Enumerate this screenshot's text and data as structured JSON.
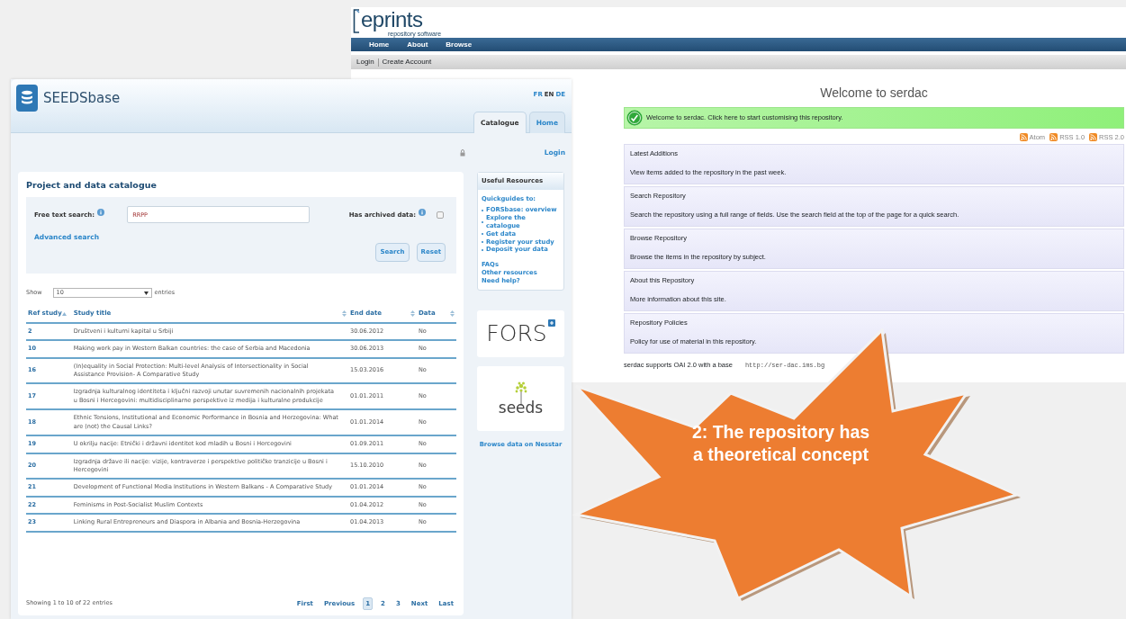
{
  "eprints": {
    "logo_text": "eprints",
    "logo_subtitle": "repository software",
    "nav": [
      "Home",
      "About",
      "Browse"
    ],
    "account_links": [
      "Login",
      "Create Account"
    ],
    "title": "Welcome to serdac",
    "notice": {
      "text": "Welcome to serdac.",
      "link": "Click here to start customising this repository."
    },
    "feeds": [
      "Atom",
      "RSS 1.0",
      "RSS 2.0"
    ],
    "panels": [
      {
        "link": "Latest Additions",
        "description": "View items added to the repository in the past week."
      },
      {
        "link": "Search Repository",
        "description": "Search the repository using a full range of fields. Use the search field at the top of the page for a quick search."
      },
      {
        "link": "Browse Repository",
        "description": "Browse the items in the repository by subject."
      },
      {
        "link": "About this Repository",
        "description": "More information about this site."
      },
      {
        "link": "Repository Policies",
        "description": "Policy for use of material in this repository."
      }
    ],
    "footer": {
      "text": "serdac supports",
      "link": "OAI 2.0",
      "text_after": "with a base",
      "url": "http://ser-dac.ims.bg"
    }
  },
  "seedsbase": {
    "brand": "SEEDSbase",
    "languages": [
      {
        "label": "FR",
        "selected": false
      },
      {
        "label": "EN",
        "selected": true
      },
      {
        "label": "DE",
        "selected": false
      }
    ],
    "tabs": [
      {
        "label": "Catalogue",
        "selected": true
      },
      {
        "label": "Home",
        "selected": false
      }
    ],
    "login": "Login",
    "catalogue": {
      "title": "Project and data catalogue",
      "search_label": "Free text search:",
      "search_value": "RRPP",
      "archived_label": "Has archived data:",
      "archived_checked": false,
      "advanced_link": "Advanced search",
      "buttons": [
        "Search",
        "Reset"
      ]
    },
    "length": {
      "show": "Show",
      "value": "10",
      "entries": "entries"
    },
    "table": {
      "columns": [
        {
          "label": "Ref study",
          "sorted": true
        },
        {
          "label": "Study title",
          "sorted": false
        },
        {
          "label": "End date",
          "sorted": false
        },
        {
          "label": "Data",
          "sorted": false
        }
      ],
      "rows": [
        [
          "2",
          "Društveni i kulturni kapital u Srbiji",
          "30.06.2012",
          "No"
        ],
        [
          "10",
          "Making work pay in Western Balkan countries: the case of Serbia and Macedonia",
          "30.06.2013",
          "No"
        ],
        [
          "16",
          "(In)equality in Social Protection: Multi-level Analysis of Intersectionality in Social Assistance Provision- A Comparative Study",
          "15.03.2016",
          "No"
        ],
        [
          "17",
          "Izgradnja kulturalnog identiteta i ključni razvoji unutar suvremenih nacionalnih projekata u Bosni i Hercegovini: multidisciplinarne perspektive iz medija i kulturalne produkcije",
          "01.01.2011",
          "No"
        ],
        [
          "18",
          "Ethnic Tensions, Institutional and Economic Performance in Bosnia and Herzegovina: What are (not) the Causal Links?",
          "01.01.2014",
          "No"
        ],
        [
          "19",
          "U okrilju nacije: Etnički i državni identitet kod mladih u Bosni i Hercegovini",
          "01.09.2011",
          "No"
        ],
        [
          "20",
          "Izgradnja države ili nacije: vizije, kontraverze i perspektive političke tranzicije u Bosni i Hercegovini",
          "15.10.2010",
          "No"
        ],
        [
          "21",
          "Development of Functional Media Institutions in Western Balkans - A Comparative Study",
          "01.01.2014",
          "No"
        ],
        [
          "22",
          "Feminisms in Post-Socialist Muslim Contexts",
          "01.04.2012",
          "No"
        ],
        [
          "23",
          "Linking Rural Entrepreneurs and Diaspora in Albania and Bosnia-Herzegovina",
          "01.04.2013",
          "No"
        ]
      ]
    },
    "info": "Showing 1 to 10 of 22 entries",
    "pagination": [
      {
        "label": "First",
        "selected": false
      },
      {
        "label": "Previous",
        "selected": false
      },
      {
        "label": "1",
        "selected": true
      },
      {
        "label": "2",
        "selected": false
      },
      {
        "label": "3",
        "selected": false
      },
      {
        "label": "Next",
        "selected": false
      },
      {
        "label": "Last",
        "selected": false
      }
    ],
    "sidebar": {
      "title": "Useful Resources",
      "quickguides_title": "Quickguides to:",
      "quickguides": [
        "FORSbase: overview",
        "Explore the catalogue",
        "Get data",
        "Register your study",
        "Deposit your data"
      ],
      "links": [
        "FAQs",
        "Other resources",
        "Need help?"
      ],
      "fors_logo": "FORS",
      "seeds_logo": "seeds",
      "nesstar_link": "Browse data on Nesstar"
    }
  },
  "callout": "2: The repository has a theoretical concept"
}
